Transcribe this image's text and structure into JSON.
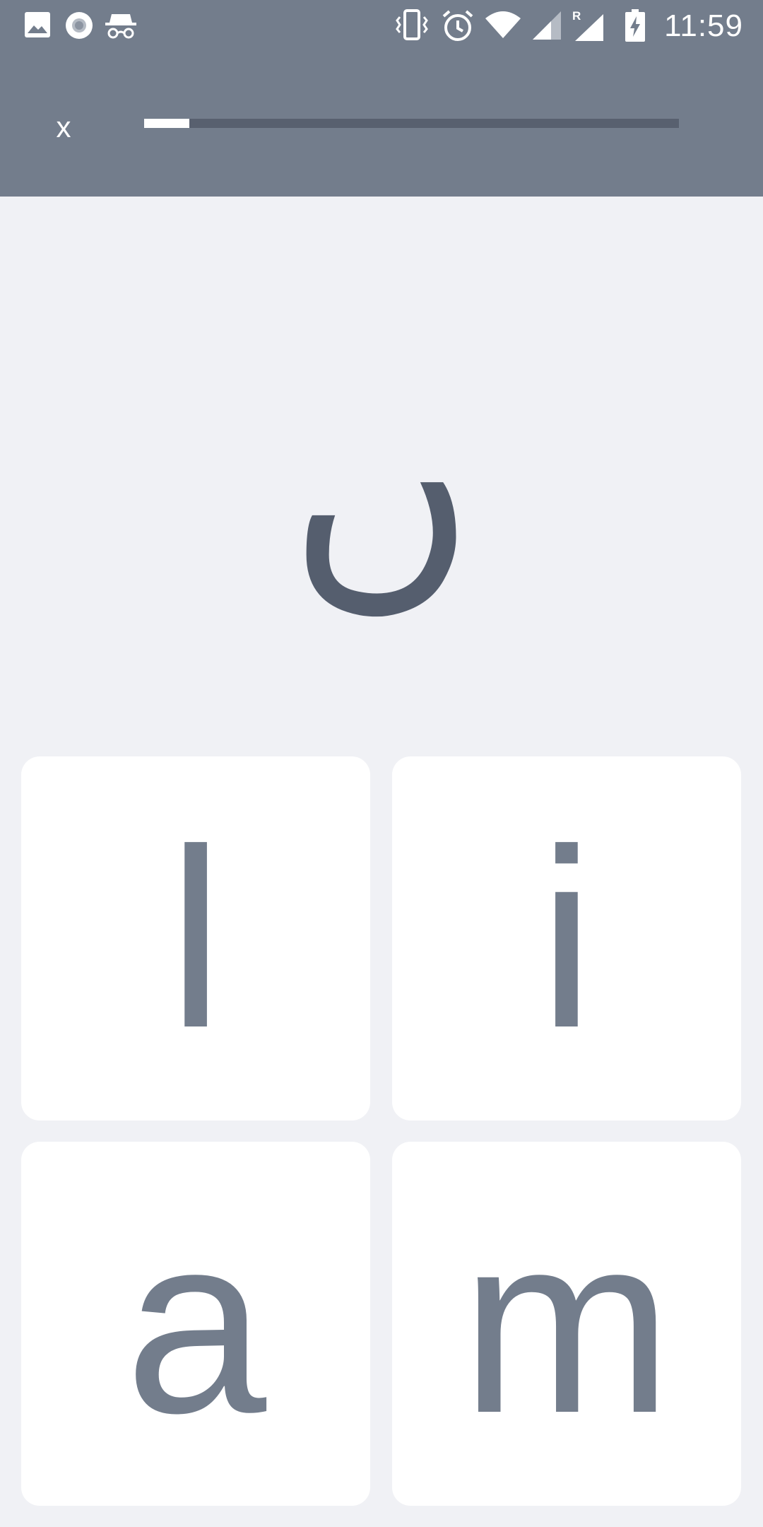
{
  "status_bar": {
    "time": "11:59",
    "left_icons": [
      "image-icon",
      "record-icon",
      "incognito-icon"
    ],
    "right_icons": [
      "vibrate-icon",
      "alarm-icon",
      "wifi-icon",
      "signal-icon",
      "roaming-signal-icon",
      "battery-charging-icon"
    ]
  },
  "top_bar": {
    "close_label": "x",
    "progress": 0.085
  },
  "prompt": {
    "character": "ں"
  },
  "choices": [
    {
      "label": "l"
    },
    {
      "label": "i"
    },
    {
      "label": "a"
    },
    {
      "label": "m"
    }
  ],
  "colors": {
    "header": "#737D8C",
    "background": "#F0F1F5",
    "card": "#FFFFFF",
    "prompt_text": "#555E6E",
    "choice_text": "#737D8C",
    "progress_track": "#58606F",
    "progress_fill": "#FFFFFF"
  }
}
